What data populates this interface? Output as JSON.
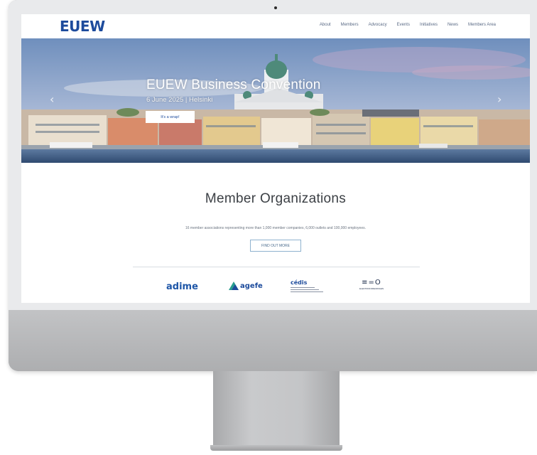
{
  "site": {
    "logo": "EUEW",
    "nav": [
      "About",
      "Members",
      "Advocacy",
      "Events",
      "Initiatives",
      "News",
      "Members Area"
    ]
  },
  "hero": {
    "title": "EUEW Business Convention",
    "subtitle": "6 June 2025 | Helsinki",
    "button": "It's a wrap!",
    "prev_arrow": "‹",
    "next_arrow": "›"
  },
  "members": {
    "title": "Member Organizations",
    "description": "16 member associations representing more than 1,000 member companies, 6,000 outlets and 100,000 employees.",
    "button": "FIND OUT MORE",
    "logos": {
      "adime": "adime",
      "agefe": "agefe",
      "cedis": "cédis",
      "eo_mark": "≡=O",
      "eo_text": "ELEKTROFORENINGEN"
    }
  },
  "colors": {
    "brand_blue": "#1d4b9c",
    "sky": "#8aa6c9",
    "water": "#3f5f86"
  }
}
